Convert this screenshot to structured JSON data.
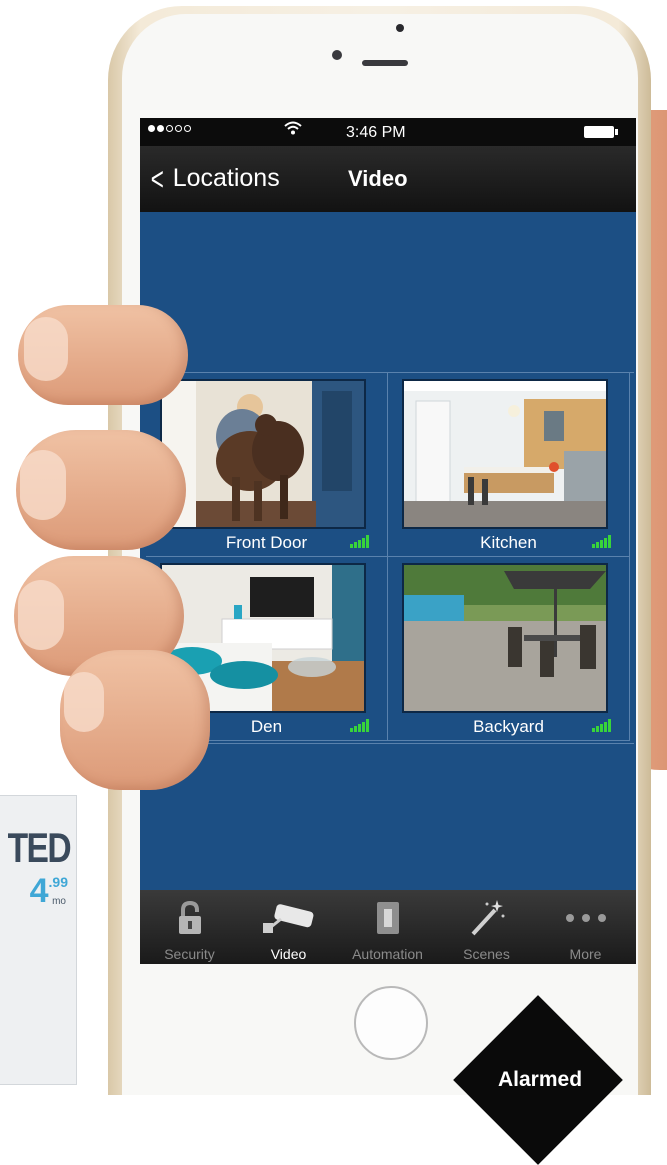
{
  "promo": {
    "word": "TED",
    "price_big": "4",
    "price_cents": ".99",
    "price_unit": "mo"
  },
  "status_bar": {
    "time": "3:46 PM"
  },
  "nav": {
    "back_label": "Locations",
    "title": "Video"
  },
  "cameras": [
    {
      "label": "Front Door",
      "signal_bars": 5
    },
    {
      "label": "Kitchen",
      "signal_bars": 5
    },
    {
      "label": "Den",
      "signal_bars": 5
    },
    {
      "label": "Backyard",
      "signal_bars": 5
    }
  ],
  "tabs": [
    {
      "label": "Security",
      "icon": "padlock-icon",
      "active": false
    },
    {
      "label": "Video",
      "icon": "security-camera-icon",
      "active": true
    },
    {
      "label": "Automation",
      "icon": "light-switch-icon",
      "active": false
    },
    {
      "label": "Scenes",
      "icon": "magic-wand-icon",
      "active": false
    },
    {
      "label": "More",
      "icon": "more-dots-icon",
      "active": false
    }
  ],
  "badge": {
    "text": "Alarmed"
  },
  "colors": {
    "screen_bg": "#1c4f84",
    "bar_bg": "#121212",
    "signal_green": "#38d43a",
    "tab_active": "#ffffff",
    "tab_inactive": "#8a8a8a"
  }
}
